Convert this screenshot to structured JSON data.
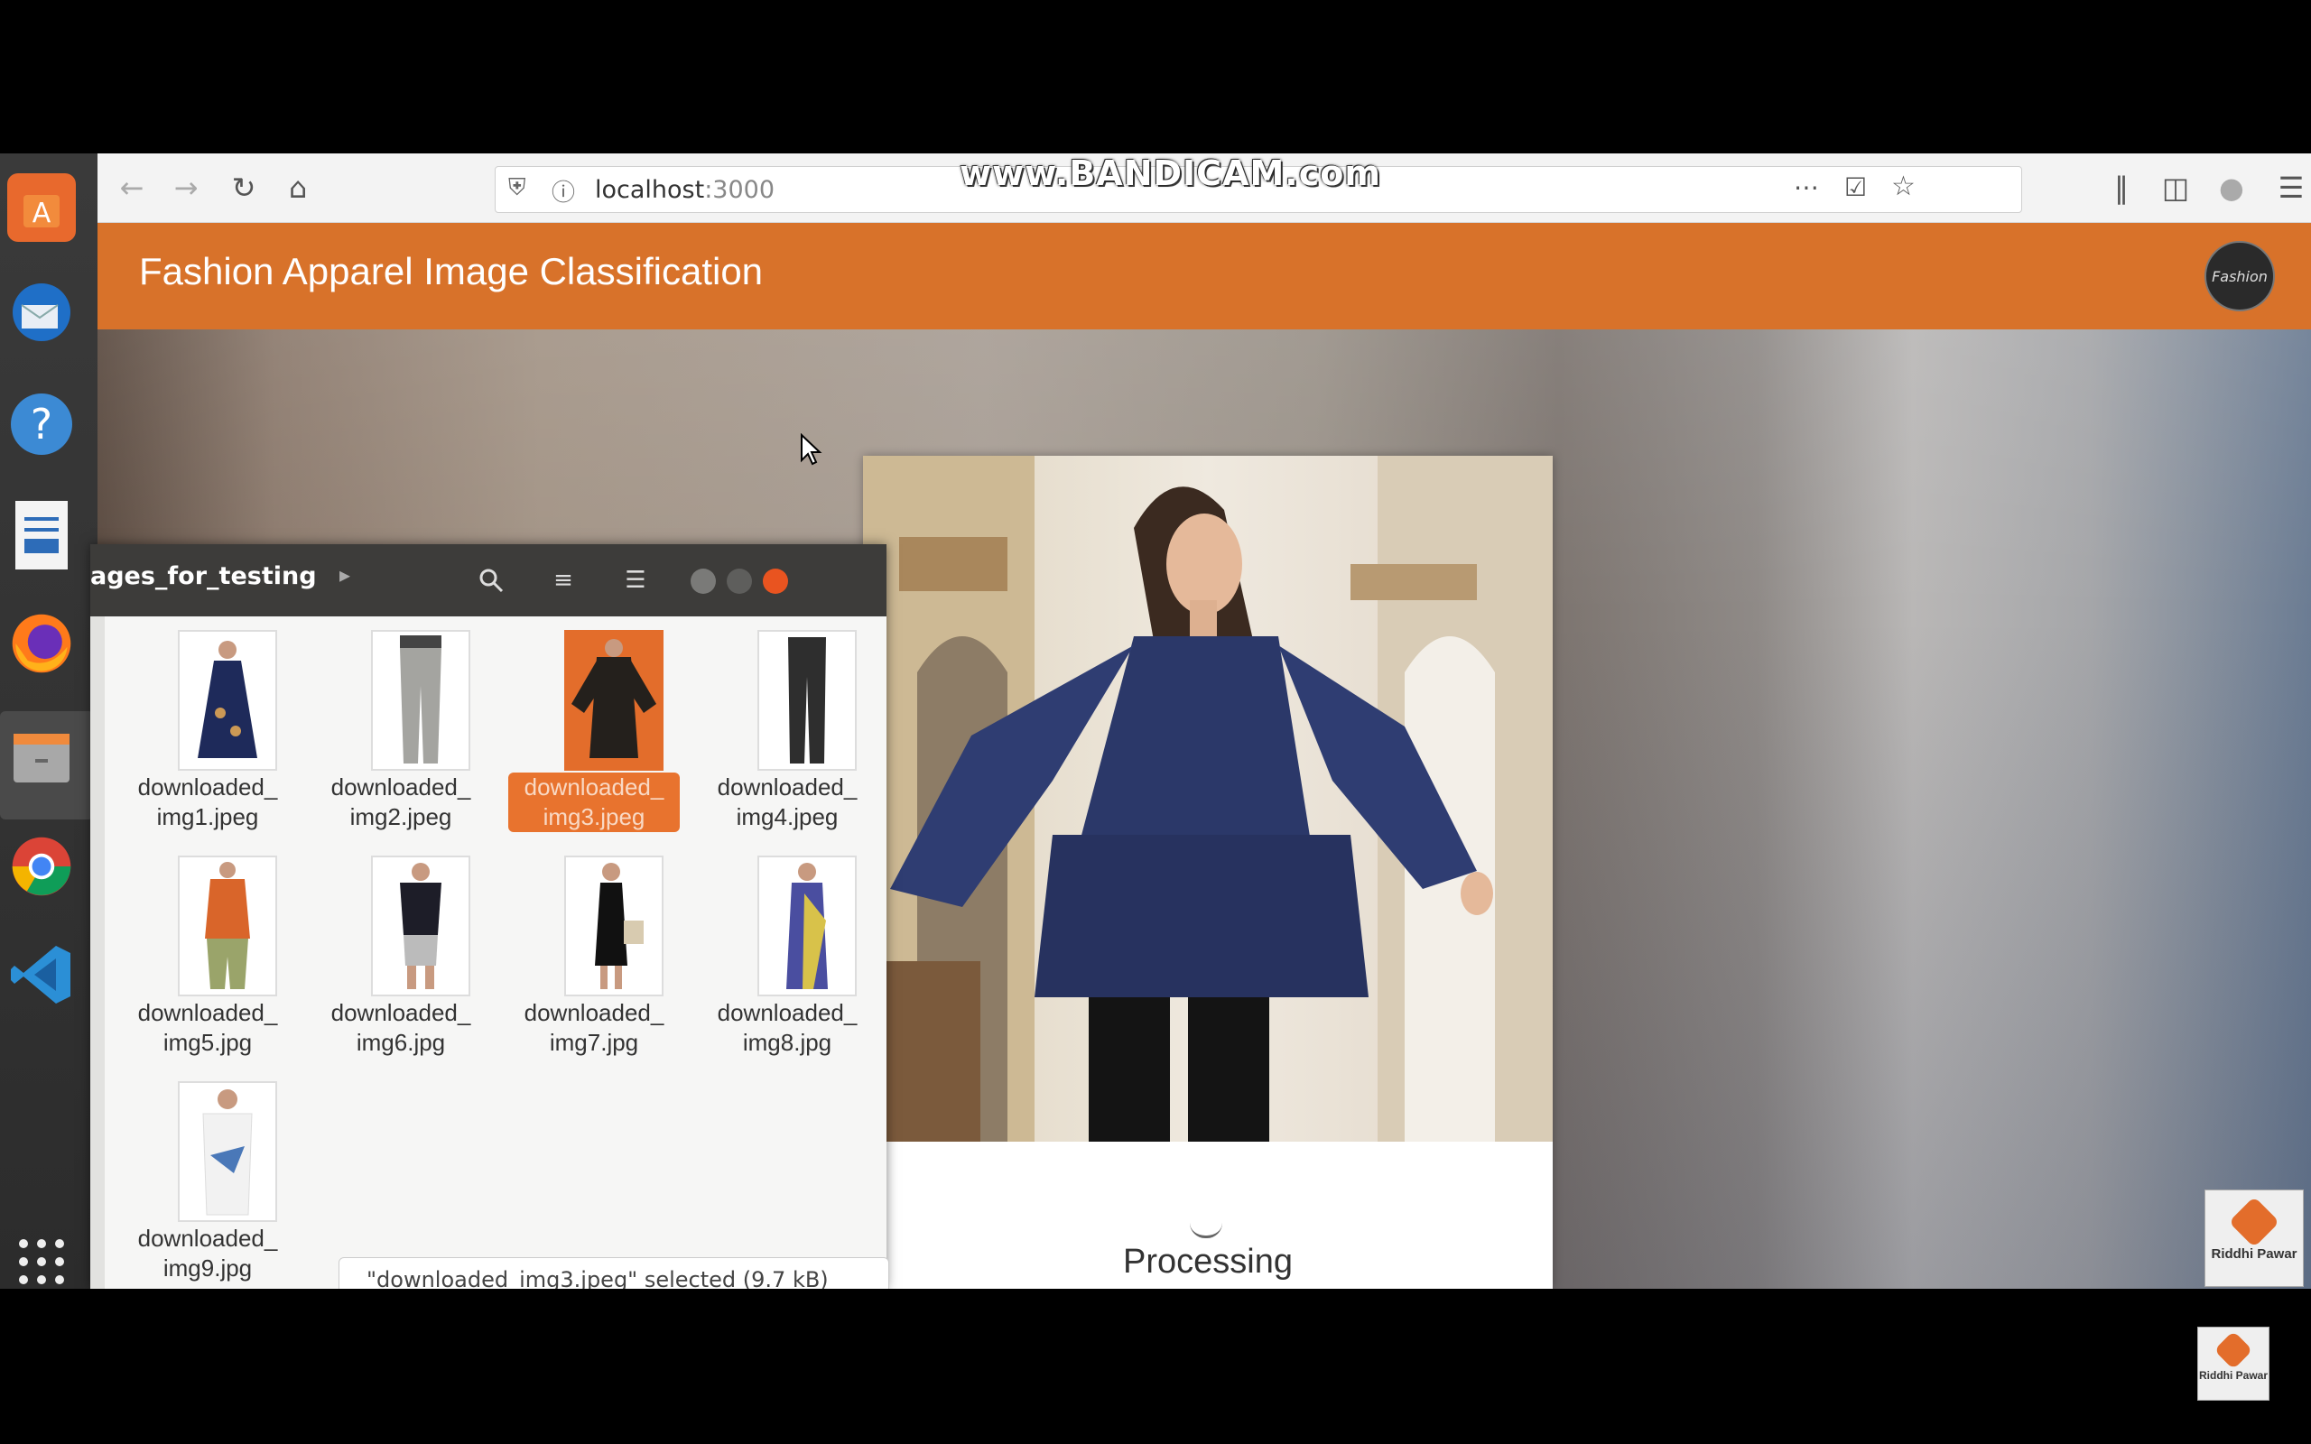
{
  "browser": {
    "url_host": "localhost",
    "url_port": ":3000",
    "recorder_watermark": "www.BANDICAM.com"
  },
  "app": {
    "title": "Fashion Apparel Image Classification",
    "logo_text": "Fashion",
    "status_text": "Processing"
  },
  "file_manager": {
    "path_label": "ages_for_testing",
    "files": [
      {
        "name_line1": "downloaded_",
        "name_line2": "img1.jpeg",
        "selected": false
      },
      {
        "name_line1": "downloaded_",
        "name_line2": "img2.jpeg",
        "selected": false
      },
      {
        "name_line1": "downloaded_",
        "name_line2": "img3.jpeg",
        "selected": true
      },
      {
        "name_line1": "downloaded_",
        "name_line2": "img4.jpeg",
        "selected": false
      },
      {
        "name_line1": "downloaded_",
        "name_line2": "img5.jpg",
        "selected": false
      },
      {
        "name_line1": "downloaded_",
        "name_line2": "img6.jpg",
        "selected": false
      },
      {
        "name_line1": "downloaded_",
        "name_line2": "img7.jpg",
        "selected": false
      },
      {
        "name_line1": "downloaded_",
        "name_line2": "img8.jpg",
        "selected": false
      },
      {
        "name_line1": "downloaded_",
        "name_line2": "img9.jpg",
        "selected": false
      }
    ],
    "status": "\"downloaded_img3.jpeg\" selected (9.7 kB)"
  },
  "overlay_logo": {
    "text": "Riddhi Pawar"
  },
  "colors": {
    "accent_orange": "#d8722a",
    "selection_orange": "#e8732e",
    "window_close": "#e95420"
  },
  "dock_icons": [
    "software-center-icon",
    "thunderbird-icon",
    "help-icon",
    "writer-icon",
    "firefox-icon",
    "files-icon",
    "chrome-icon",
    "vscode-icon",
    "apps-grid-icon"
  ]
}
